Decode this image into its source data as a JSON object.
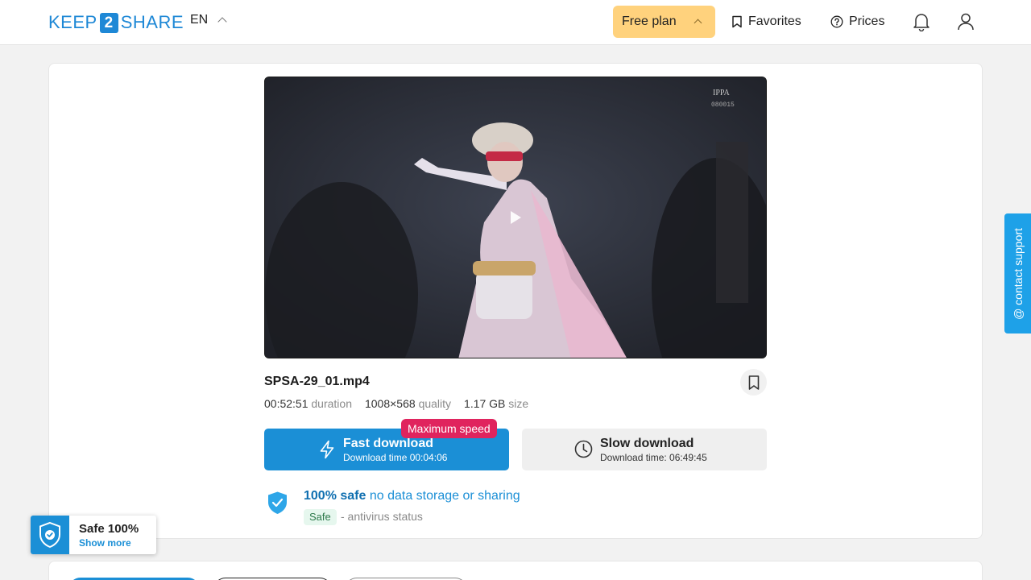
{
  "header": {
    "logo_left": "KEEP",
    "logo_mid": "2",
    "logo_right": "SHARE",
    "lang": "EN",
    "plan_label": "Free plan",
    "favorites_label": "Favorites",
    "prices_label": "Prices"
  },
  "file": {
    "name": "SPSA-29_01.mp4",
    "duration_value": "00:52:51",
    "duration_label": "duration",
    "quality_value": "1008×568",
    "quality_label": "quality",
    "size_value": "1.17 GB",
    "size_label": "size",
    "watermark_top": "IPPA",
    "watermark_bottom": "080015"
  },
  "download": {
    "fast_label": "Fast download",
    "fast_time": "Download time 00:04:06",
    "badge": "Maximum speed",
    "slow_label": "Slow download",
    "slow_time": "Download time: 06:49:45"
  },
  "safety": {
    "bold": "100% safe",
    "rest": "no data storage or sharing",
    "tag": "Safe",
    "status": "- antivirus status",
    "widget_title": "Safe 100%",
    "widget_link": "Show more"
  },
  "support": {
    "label": "@ contact support"
  },
  "colors": {
    "accent": "#1b8fd6",
    "plan": "#ffd27d",
    "badge": "#e0245e",
    "support": "#1ea1e8"
  }
}
